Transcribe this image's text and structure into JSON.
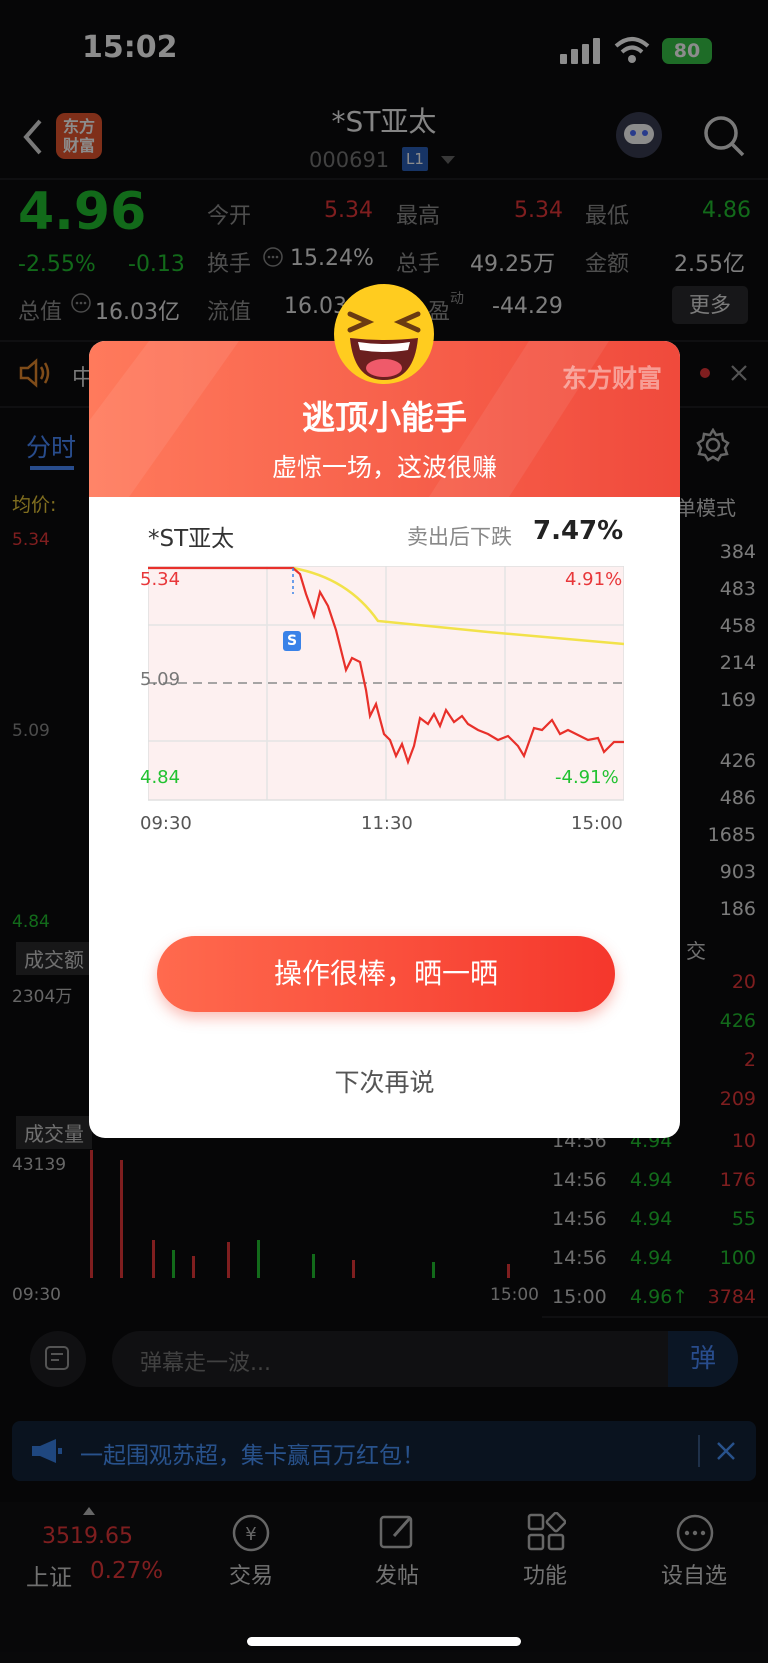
{
  "status_bar": {
    "time": "15:02",
    "battery": "80"
  },
  "header": {
    "title": "*ST亚太",
    "code": "000691",
    "level_badge": "L1",
    "logo_text": "东方财富"
  },
  "quote": {
    "price": "4.96",
    "change_pct": "-2.55%",
    "change": "-0.13",
    "open_label": "今开",
    "open": "5.34",
    "high_label": "最高",
    "high": "5.34",
    "low_label": "最低",
    "low": "4.86",
    "turnover_label": "换手",
    "turnover": "15.24%",
    "volume_label": "总手",
    "volume": "49.25万",
    "amount_label": "金额",
    "amount": "2.55亿",
    "mktcap_label": "总值",
    "mktcap": "16.03亿",
    "float_label": "流值",
    "float": "16.03",
    "pe_label": "盈",
    "pe_sup": "动",
    "pe": "-44.29",
    "more": "更多"
  },
  "notice": {
    "text": "中"
  },
  "tabs": {
    "active": "分时",
    "mode": "单模式"
  },
  "main_chart": {
    "avg_label": "均价:",
    "top": "5.34",
    "mid": "5.09",
    "bottom": "4.84",
    "amount_tag": "成交额",
    "amount_max": "2304万",
    "volume_tag": "成交量",
    "volume_max": "43139",
    "time_start": "09:30",
    "time_end": "15:00",
    "trade_label": "交"
  },
  "order_book": [
    "384",
    "483",
    "458",
    "214",
    "169",
    "426",
    "486",
    "1685",
    "903",
    "186"
  ],
  "trades": [
    {
      "time": "",
      "price": "",
      "vol": "20"
    },
    {
      "time": "",
      "price": "",
      "vol": "426"
    },
    {
      "time": "",
      "price": "",
      "vol": "2"
    },
    {
      "time": "",
      "price": "",
      "vol": "209"
    },
    {
      "time": "14:56",
      "price": "4.94",
      "vol": "10"
    },
    {
      "time": "14:56",
      "price": "4.94",
      "vol": "176"
    },
    {
      "time": "14:56",
      "price": "4.94",
      "vol": "55"
    },
    {
      "time": "14:56",
      "price": "4.94",
      "vol": "100"
    },
    {
      "time": "15:00",
      "price": "4.96↑",
      "vol": "3784"
    }
  ],
  "comment": {
    "placeholder": "弹幕走一波...",
    "send": "弹"
  },
  "ad": {
    "text": "一起围观苏超，集卡赢百万红包！"
  },
  "tabbar": {
    "index_value": "3519.65",
    "index_name": "上证",
    "index_pct": "0.27%",
    "items": [
      {
        "label": "交易"
      },
      {
        "label": "发帖"
      },
      {
        "label": "功能"
      },
      {
        "label": "设自选"
      }
    ]
  },
  "modal": {
    "brand": "东方财富",
    "title": "逃顶小能手",
    "subtitle": "虚惊一场，这波很赚",
    "stock": "*ST亚太",
    "drop_label": "卖出后下跌",
    "drop_value": "7.47%",
    "y_top": "5.34",
    "y_mid": "5.09",
    "y_bottom": "4.84",
    "pct_top": "4.91%",
    "pct_bottom": "-4.91%",
    "x_labels": [
      "09:30",
      "11:30",
      "15:00"
    ],
    "sell_marker": "S",
    "share_button": "操作很棒，晒一晒",
    "later_button": "下次再说"
  },
  "colors": {
    "up": "#e8373a",
    "down": "#22c231",
    "accent": "#f04a3c",
    "avg_line": "#f2e24a"
  }
}
